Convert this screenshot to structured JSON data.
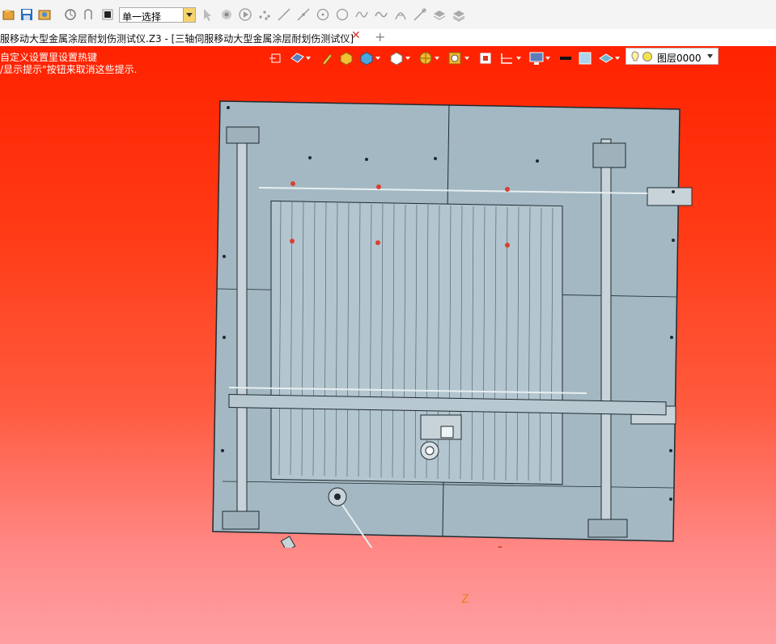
{
  "toolbar": {
    "select_mode": "单一选择",
    "icons": [
      "open-file-icon",
      "save-icon",
      "export-icon",
      "rotate-icon",
      "undo-icon",
      "stop-icon",
      "pointer-icon",
      "filter-icon",
      "play-icon",
      "points-icon",
      "line-icon",
      "line-icon-2",
      "circle-center-icon",
      "circle-icon",
      "spline-icon",
      "curve-icon",
      "arc-icon",
      "tangent-line-icon",
      "layer-stack-icon",
      "layer-stack-icon-2"
    ]
  },
  "tabs": {
    "active_title": "服移动大型金属涂层耐划伤测试仪.Z3 - [三轴伺服移动大型金属涂层耐划伤测试仪]",
    "close": "✕",
    "new": "+"
  },
  "viewport": {
    "hint_line1": "自定义设置里设置热键",
    "hint_line2": "/显示提示\"按钮来取消这些提示.",
    "layer_name": "图层0000",
    "axis_label": "Z",
    "gradient_top": "#ff2200",
    "gradient_bottom": "#ff9fa2",
    "model_color": "#a3b8c2"
  }
}
